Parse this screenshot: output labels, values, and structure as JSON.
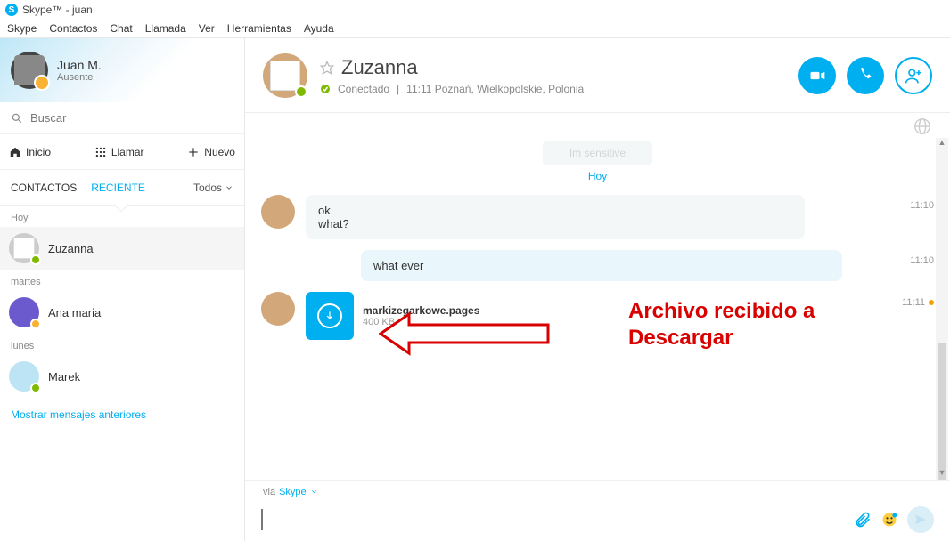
{
  "window": {
    "title": "Skype™ - juan"
  },
  "menu": {
    "items": [
      "Skype",
      "Contactos",
      "Chat",
      "Llamada",
      "Ver",
      "Herramientas",
      "Ayuda"
    ]
  },
  "self": {
    "name": "Juan M.",
    "status": "Ausente"
  },
  "search": {
    "placeholder": "Buscar"
  },
  "nav": {
    "home": "Inicio",
    "call": "Llamar",
    "new": "Nuevo"
  },
  "tabs": {
    "contacts": "CONTACTOS",
    "recent": "RECIENTE",
    "filter": "Todos"
  },
  "groups": {
    "g0": {
      "label": "Hoy"
    },
    "g1": {
      "label": "martes"
    },
    "g2": {
      "label": "lunes"
    }
  },
  "contacts": {
    "c0": {
      "name": "Zuzanna"
    },
    "c1": {
      "name": "Ana maria"
    },
    "c2": {
      "name": "Marek"
    }
  },
  "show_older": "Mostrar mensajes anteriores",
  "chat": {
    "title": "Zuzanna",
    "status": "Conectado",
    "sep": "|",
    "location": "11:11 Poznań, Wielkopolskie, Polonia",
    "faded": "Im sensitive",
    "today": "Hoy",
    "m1": {
      "line1": "ok",
      "line2": "what?",
      "time": "11:10"
    },
    "m2": {
      "text": "what ever",
      "time": "11:10"
    },
    "file": {
      "name": "markizegarkowe.pages",
      "size": "400 KB",
      "time": "11:11"
    },
    "via_prefix": "via",
    "via_app": "Skype"
  },
  "annotation": {
    "line1": "Archivo recibido a",
    "line2": "Descargar"
  }
}
